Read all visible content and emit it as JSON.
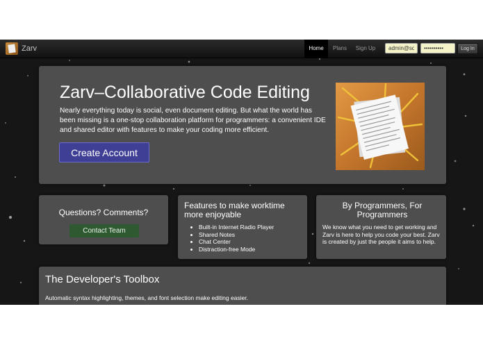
{
  "navbar": {
    "brand": "Zarv",
    "links": [
      {
        "label": "Home",
        "active": true
      },
      {
        "label": "Plans",
        "active": false
      },
      {
        "label": "Sign Up",
        "active": false
      }
    ],
    "username_value": "admin@squ",
    "password_value": "••••••••••",
    "login_label": "Log In"
  },
  "hero": {
    "title": "Zarv–Collaborative Code Editing",
    "description": "Nearly everything today is social, even document editing. But what the world has been missing is a one-stop collaboration platform for programmers: a convenient IDE and shared editor with features to make your coding more efficient.",
    "cta_label": "Create Account"
  },
  "contact": {
    "title": "Questions? Comments?",
    "button_label": "Contact Team"
  },
  "features": {
    "title": "Features to make worktime more enjoyable",
    "items": [
      "Built-in Internet Radio Player",
      "Shared Notes",
      "Chat Center",
      "Distraction-free Mode"
    ]
  },
  "programmers": {
    "title": "By Programmers, For Programmers",
    "description": "We know what you need to get working and Zarv is here to help you code your best. Zarv is created by just the people it aims to help."
  },
  "toolbox": {
    "title": "The Developer's Toolbox",
    "description": "Automatic syntax highlighting, themes, and font selection make editing easier."
  },
  "colors": {
    "background": "#161616",
    "panel": "#5a5a5a",
    "cta": "#3f3f96",
    "contact_button": "#2f5a31",
    "input_fill": "#f4f4c8"
  }
}
